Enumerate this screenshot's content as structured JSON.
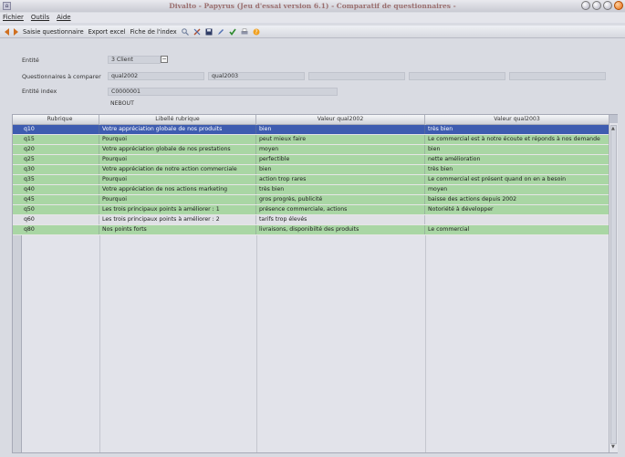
{
  "window": {
    "title": "Divalto - Papyrus (Jeu d'essai version 6.1) - Comparatif de questionnaires -"
  },
  "menu": [
    "Fichier",
    "Outils",
    "Aide"
  ],
  "toolbar": {
    "entry_label": "Saisie questionnaire",
    "export_label": "Export excel",
    "index_label": "Fiche de l'index"
  },
  "form": {
    "entity_label": "Entité",
    "entity_value": "3 Client",
    "compare_label": "Questionnaires à comparer",
    "compare_1": "qual2002",
    "compare_2": "qual2003",
    "index_label": "Entité index",
    "index_code": "C0000001",
    "index_name": "NEBOUT"
  },
  "table": {
    "headers": [
      "Rubrique",
      "Libellé rubrique",
      "Valeur qual2002",
      "Valeur qual2003"
    ],
    "rows": [
      {
        "code": "q10",
        "label": "Votre appréciation globale de nos produits",
        "v2002": "bien",
        "v2003": "très bien",
        "state": "selected"
      },
      {
        "code": "q15",
        "label": "Pourquoi",
        "v2002": "peut mieux faire",
        "v2003": "Le commercial est à notre écoute et réponds à nos demande",
        "state": "green"
      },
      {
        "code": "q20",
        "label": "Votre appréciation globale de nos prestations",
        "v2002": "moyen",
        "v2003": "bien",
        "state": "green"
      },
      {
        "code": "q25",
        "label": "Pourquoi",
        "v2002": "perfectible",
        "v2003": "nette amélioration",
        "state": "green"
      },
      {
        "code": "q30",
        "label": "Votre appréciation de notre action commerciale",
        "v2002": "bien",
        "v2003": "très bien",
        "state": "green"
      },
      {
        "code": "q35",
        "label": "Pourquoi",
        "v2002": "action trop rares",
        "v2003": "Le commercial est présent quand on en a besoin",
        "state": "green"
      },
      {
        "code": "q40",
        "label": "Votre appréciation de nos actions marketing",
        "v2002": "très bien",
        "v2003": "moyen",
        "state": "green"
      },
      {
        "code": "q45",
        "label": "Pourquoi",
        "v2002": "gros progrès, publicité",
        "v2003": "baisse des actions depuis 2002",
        "state": "green"
      },
      {
        "code": "q50",
        "label": "Les trois principaux points à améliorer : 1",
        "v2002": "présence commerciale, actions",
        "v2003": "Notoriété à développer",
        "state": "green"
      },
      {
        "code": "q60",
        "label": "Les trois principaux points à améliorer : 2",
        "v2002": "tarifs trop élevés",
        "v2003": "",
        "state": "gray"
      },
      {
        "code": "q80",
        "label": "Nos points forts",
        "v2002": "livraisons, disponibilté des produits",
        "v2003": "Le commercial",
        "state": "green"
      }
    ]
  },
  "colors": {
    "selected_row": "#3e5cb0",
    "green_row": "#a9d6a4",
    "gray_row": "#e0e1e6",
    "toolbar_arrow": "#d07020"
  }
}
